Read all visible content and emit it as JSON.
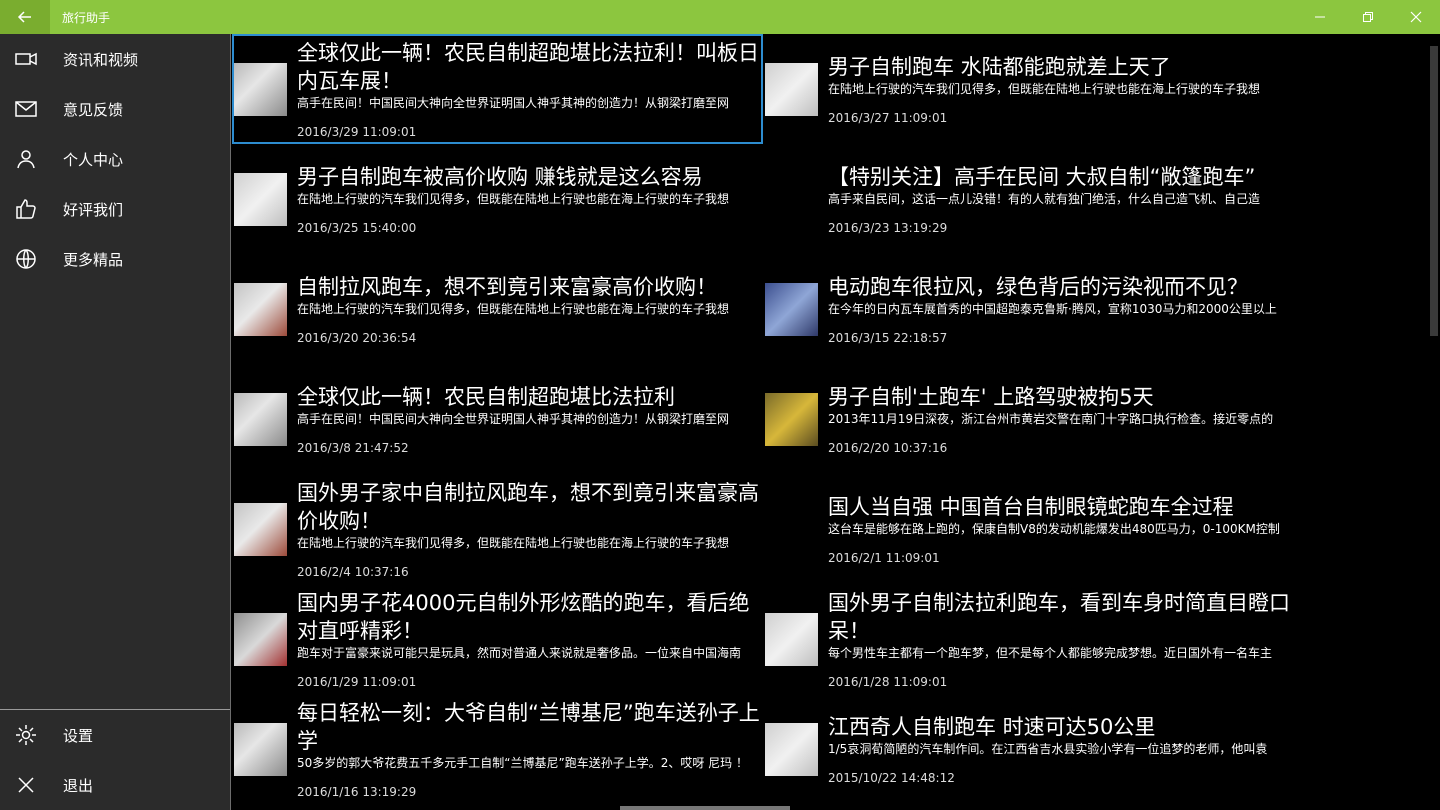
{
  "window": {
    "title": "旅行助手",
    "accent": "#8cc63f"
  },
  "sidebar": {
    "items": [
      {
        "label": "资讯和视频",
        "icon": "video-icon"
      },
      {
        "label": "意见反馈",
        "icon": "mail-icon"
      },
      {
        "label": "个人中心",
        "icon": "person-icon"
      },
      {
        "label": "好评我们",
        "icon": "thumbs-up-icon"
      },
      {
        "label": "更多精品",
        "icon": "globe-icon"
      }
    ],
    "bottom": [
      {
        "label": "设置",
        "icon": "gear-icon"
      },
      {
        "label": "退出",
        "icon": "close-icon"
      }
    ]
  },
  "articles": [
    {
      "headline": "全球仅此一辆！农民自制超跑堪比法拉利！叫板日内瓦车展！",
      "summary": "高手在民间！中国民间大神向全世界证明国人神乎其神的创造力！从钢梁打磨至网",
      "date": "2016/3/29 11:09:01",
      "thumb": "gray",
      "selected": true
    },
    {
      "headline": "男子自制跑车 水陆都能跑就差上天了",
      "summary": "在陆地上行驶的汽车我们见得多，但既能在陆地上行驶也能在海上行驶的车子我想",
      "date": "2016/3/27 11:09:01",
      "thumb": "pale"
    },
    {
      "headline": "男子自制跑车被高价收购 赚钱就是这么容易",
      "summary": "在陆地上行驶的汽车我们见得多，但既能在陆地上行驶也能在海上行驶的车子我想",
      "date": "2016/3/25 15:40:00",
      "thumb": "pale"
    },
    {
      "headline": "【特别关注】高手在民间 大叔自制“敞篷跑车”",
      "summary": "高手来自民间，这话一点儿没错！有的人就有独门绝活，什么自己造飞机、自己造",
      "date": "2016/3/23 13:19:29",
      "thumb": "none"
    },
    {
      "headline": "自制拉风跑车，想不到竟引来富豪高价收购！",
      "summary": "在陆地上行驶的汽车我们见得多，但既能在陆地上行驶也能在海上行驶的车子我想",
      "date": "2016/3/20 20:36:54",
      "thumb": "red"
    },
    {
      "headline": "电动跑车很拉风，绿色背后的污染视而不见？",
      "summary": "在今年的日内瓦车展首秀的中国超跑泰克鲁斯·腾风，宣称1030马力和2000公里以上",
      "date": "2016/3/15 22:18:57",
      "thumb": "blue"
    },
    {
      "headline": "全球仅此一辆！农民自制超跑堪比法拉利",
      "summary": "高手在民间！中国民间大神向全世界证明国人神乎其神的创造力！从钢梁打磨至网",
      "date": "2016/3/8 21:47:52",
      "thumb": "gray"
    },
    {
      "headline": "男子自制'土跑车' 上路驾驶被拘5天",
      "summary": "2013年11月19日深夜，浙江台州市黄岩交警在南门十字路口执行检查。接近零点的",
      "date": "2016/2/20 10:37:16",
      "thumb": "yellow"
    },
    {
      "headline": "国外男子家中自制拉风跑车，想不到竟引来富豪高价收购！",
      "summary": "在陆地上行驶的汽车我们见得多，但既能在陆地上行驶也能在海上行驶的车子我想",
      "date": "2016/2/4 10:37:16",
      "thumb": "red"
    },
    {
      "headline": "国人当自强 中国首台自制眼镜蛇跑车全过程",
      "summary": "这台车是能够在路上跑的，保康自制V8的发动机能爆发出480匹马力，0-100KM控制",
      "date": "2016/2/1 11:09:01",
      "thumb": "none"
    },
    {
      "headline": "国内男子花4000元自制外形炫酷的跑车，看后绝对直呼精彩！",
      "summary": "跑车对于富豪来说可能只是玩具，然而对普通人来说就是奢侈品。一位来自中国海南",
      "date": "2016/1/29 11:09:01",
      "thumb": "sports"
    },
    {
      "headline": "国外男子自制法拉利跑车，看到车身时简直目瞪口呆！",
      "summary": "每个男性车主都有一个跑车梦，但不是每个人都能够完成梦想。近日国外有一名车主",
      "date": "2016/1/28 11:09:01",
      "thumb": "pale"
    },
    {
      "headline": "每日轻松一刻：大爷自制“兰博基尼”跑车送孙子上学",
      "summary": "50多岁的郭大爷花费五千多元手工自制“兰博基尼”跑车送孙子上学。2、哎呀 尼玛 ！",
      "date": "2016/1/16 13:19:29",
      "thumb": "gray"
    },
    {
      "headline": "江西奇人自制跑车 时速可达50公里",
      "summary": "1/5哀洞荀简陋的汽车制作间。在江西省吉水县实验小学有一位追梦的老师，他叫袁",
      "date": "2015/10/22 14:48:12",
      "thumb": "pale"
    }
  ]
}
